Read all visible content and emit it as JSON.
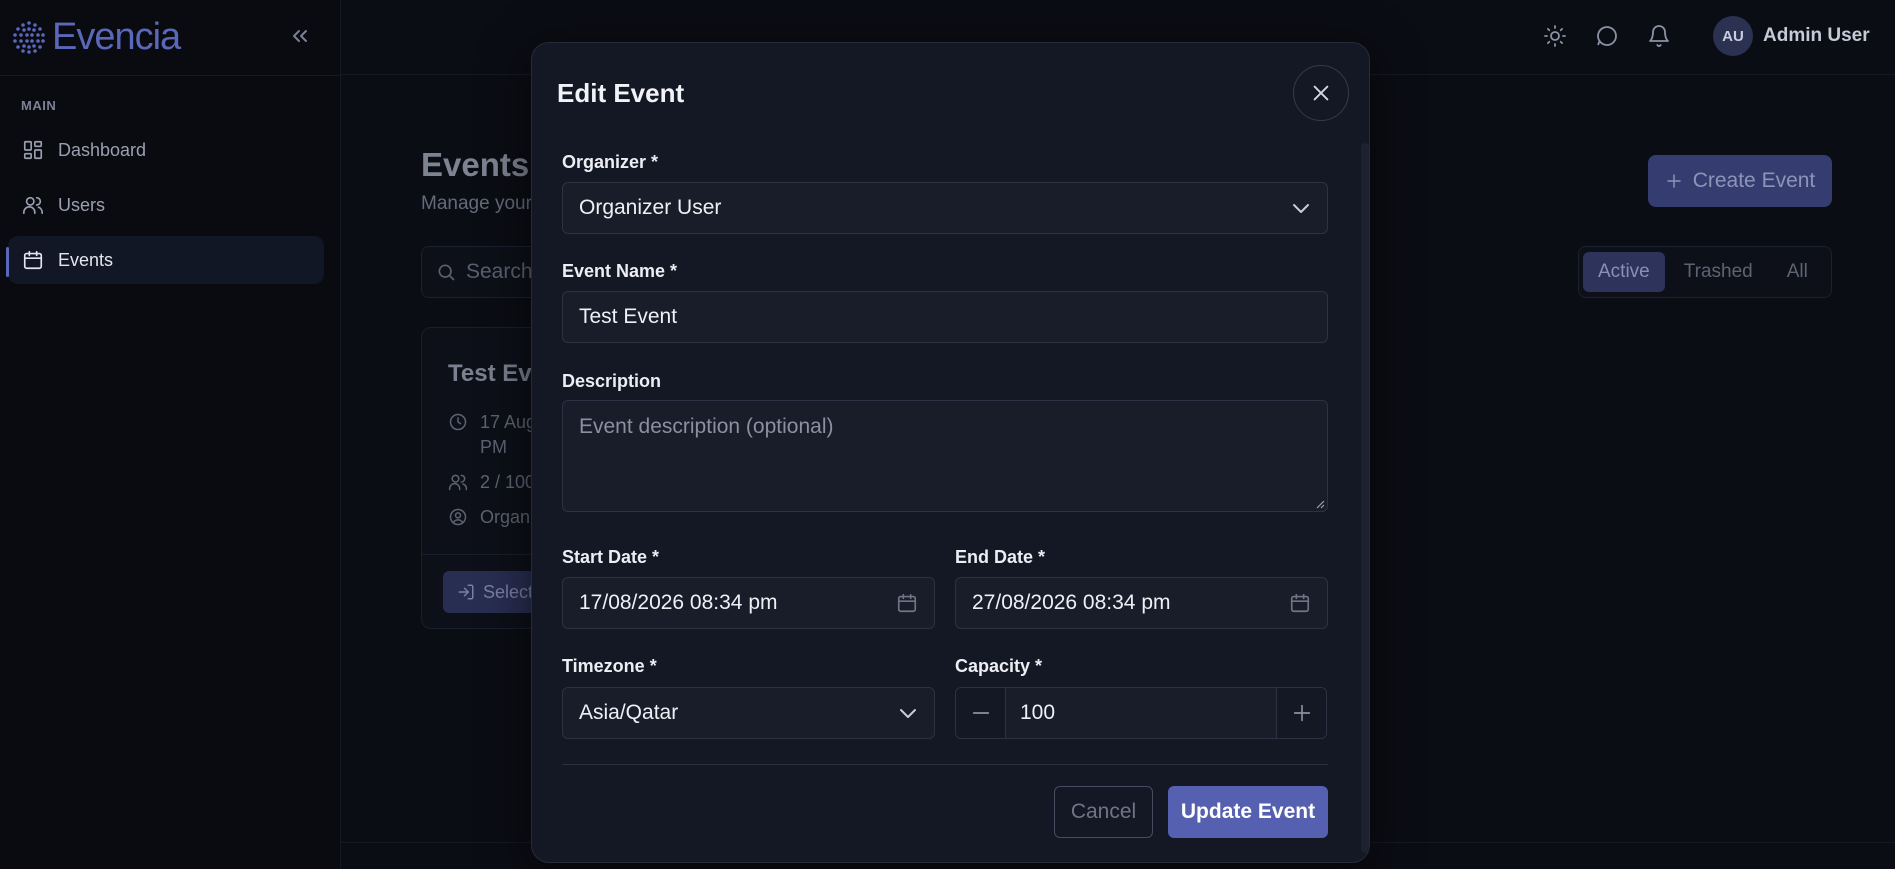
{
  "app": {
    "name": "Evencia",
    "accent_color": "#5b67b8"
  },
  "sidebar": {
    "section_label": "MAIN",
    "items": [
      {
        "label": "Dashboard",
        "icon": "dashboard-icon"
      },
      {
        "label": "Users",
        "icon": "users-icon"
      },
      {
        "label": "Events",
        "icon": "calendar-icon",
        "active": true
      }
    ]
  },
  "topbar": {
    "icons": [
      "sun-icon",
      "chat-icon",
      "bell-icon"
    ],
    "avatar_initials": "AU",
    "user_name": "Admin User"
  },
  "page": {
    "title": "Events",
    "subtitle": "Manage your",
    "create_button": "Create Event",
    "search_placeholder": "Search",
    "filters": [
      "Active",
      "Trashed",
      "All"
    ],
    "active_filter": "Active",
    "card": {
      "title": "Test Eve",
      "date_line1": "17 Aug",
      "date_line2": "PM",
      "capacity": "2 / 100",
      "organizer": "Organi",
      "select_button": "Select"
    }
  },
  "modal": {
    "title": "Edit Event",
    "organizer": {
      "label": "Organizer *",
      "value": "Organizer User"
    },
    "event_name": {
      "label": "Event Name *",
      "value": "Test Event"
    },
    "description": {
      "label": "Description",
      "placeholder": "Event description (optional)"
    },
    "start_date": {
      "label": "Start Date *",
      "value": "17/08/2026 08:34 pm"
    },
    "end_date": {
      "label": "End Date *",
      "value": "27/08/2026 08:34 pm"
    },
    "timezone": {
      "label": "Timezone *",
      "value": "Asia/Qatar"
    },
    "capacity": {
      "label": "Capacity *",
      "value": "100"
    },
    "cancel_label": "Cancel",
    "submit_label": "Update Event"
  }
}
